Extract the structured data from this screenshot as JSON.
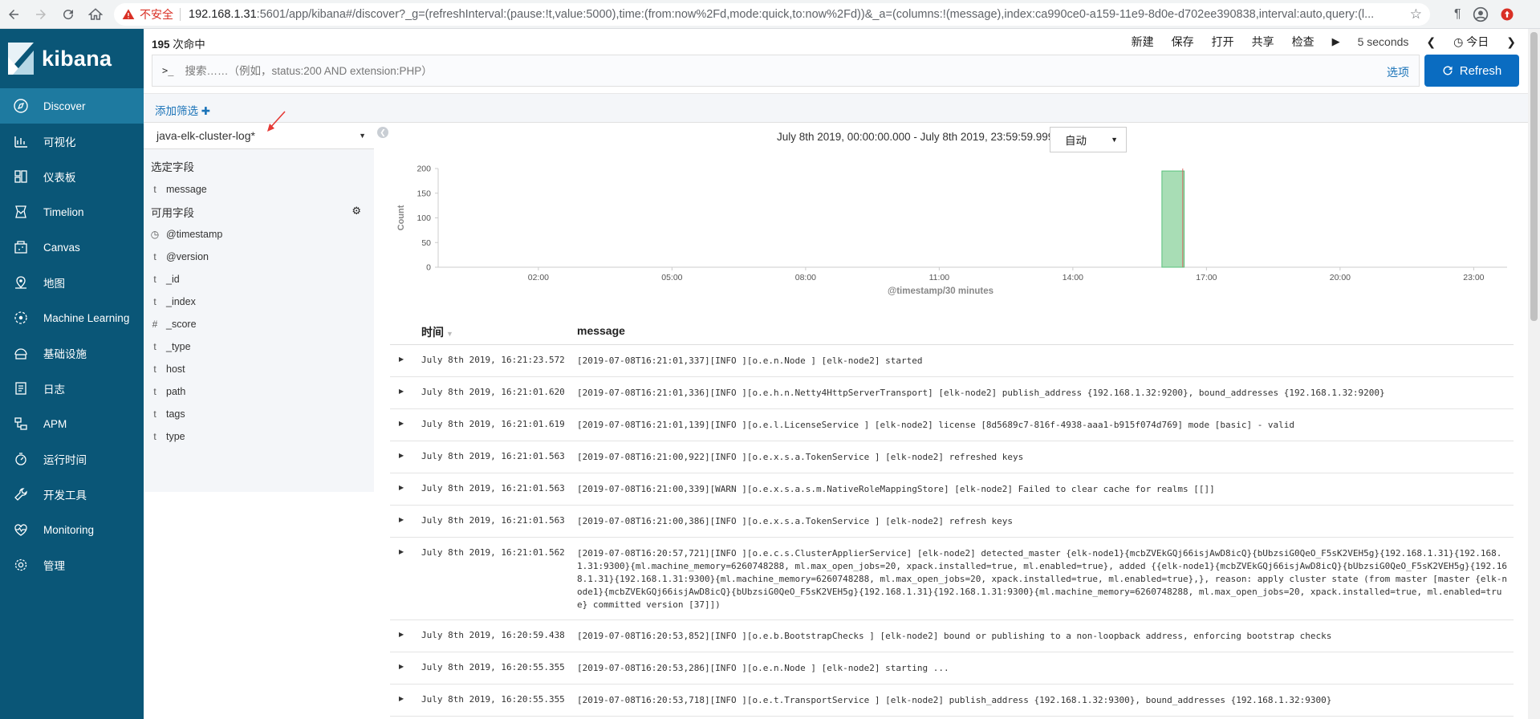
{
  "browser": {
    "security_label": "不安全",
    "url_host": "192.168.1.31",
    "url_rest": ":5601/app/kibana#/discover?_g=(refreshInterval:(pause:!t,value:5000),time:(from:now%2Fd,mode:quick,to:now%2Fd))&_a=(columns:!(message),index:ca990ce0-a159-11e9-8d0e-d702ee390838,interval:auto,query:(l..."
  },
  "brand": {
    "name": "kibana"
  },
  "sidebar": {
    "items": [
      {
        "label": "Discover",
        "icon": "compass-icon"
      },
      {
        "label": "可视化",
        "icon": "visualize-icon"
      },
      {
        "label": "仪表板",
        "icon": "dashboard-icon"
      },
      {
        "label": "Timelion",
        "icon": "timelion-icon"
      },
      {
        "label": "Canvas",
        "icon": "canvas-icon"
      },
      {
        "label": "地图",
        "icon": "map-icon"
      },
      {
        "label": "Machine Learning",
        "icon": "ml-icon"
      },
      {
        "label": "基础设施",
        "icon": "infrastructure-icon"
      },
      {
        "label": "日志",
        "icon": "logs-icon"
      },
      {
        "label": "APM",
        "icon": "apm-icon"
      },
      {
        "label": "运行时间",
        "icon": "uptime-icon"
      },
      {
        "label": "开发工具",
        "icon": "devtools-icon"
      },
      {
        "label": "Monitoring",
        "icon": "monitoring-icon"
      },
      {
        "label": "管理",
        "icon": "gear-icon"
      }
    ]
  },
  "toolbar": {
    "hits_count": "195",
    "hits_label": "次命中",
    "menu": [
      "新建",
      "保存",
      "打开",
      "共享",
      "检查"
    ],
    "refresh_interval": "5 seconds",
    "date_label": "今日",
    "search_placeholder": "搜索……（例如，status:200 AND extension:PHP）",
    "options_label": "选项",
    "refresh_label": "Refresh"
  },
  "filters": {
    "add_label": "添加筛选"
  },
  "fields_panel": {
    "index_pattern": "java-elk-cluster-log*",
    "selected_title": "选定字段",
    "selected": [
      {
        "type": "t",
        "name": "message"
      }
    ],
    "available_title": "可用字段",
    "available": [
      {
        "type": "◷",
        "name": "@timestamp"
      },
      {
        "type": "t",
        "name": "@version"
      },
      {
        "type": "t",
        "name": "_id"
      },
      {
        "type": "t",
        "name": "_index"
      },
      {
        "type": "#",
        "name": "_score"
      },
      {
        "type": "t",
        "name": "_type"
      },
      {
        "type": "t",
        "name": "host"
      },
      {
        "type": "t",
        "name": "path"
      },
      {
        "type": "t",
        "name": "tags"
      },
      {
        "type": "t",
        "name": "type"
      }
    ]
  },
  "histogram_header": {
    "time_range": "July 8th 2019, 00:00:00.000 - July 8th 2019, 23:59:59.999 —",
    "interval": "自动"
  },
  "chart_data": {
    "type": "bar",
    "xlabel": "@timestamp/30 minutes",
    "ylabel": "Count",
    "ylim": [
      0,
      200
    ],
    "yticks": [
      0,
      50,
      100,
      150,
      200
    ],
    "xlim_hours": [
      -0.25,
      23.75
    ],
    "xticks": [
      "02:00",
      "05:00",
      "08:00",
      "11:00",
      "14:00",
      "17:00",
      "20:00",
      "23:00"
    ],
    "bucket_minutes": 30,
    "bars": [
      {
        "start": "16:00",
        "value": 195
      }
    ],
    "current_time_marker": "16:28",
    "bar_color": "#a8ddb5",
    "bar_border": "#57c17b",
    "marker_color": "#d9534f"
  },
  "table": {
    "headers": {
      "time": "时间",
      "message": "message"
    },
    "rows": [
      {
        "time": "July 8th 2019, 16:21:23.572",
        "message": "[2019-07-08T16:21:01,337][INFO ][o.e.n.Node               ] [elk-node2] started"
      },
      {
        "time": "July 8th 2019, 16:21:01.620",
        "message": "[2019-07-08T16:21:01,336][INFO ][o.e.h.n.Netty4HttpServerTransport] [elk-node2] publish_address {192.168.1.32:9200}, bound_addresses {192.168.1.32:9200}"
      },
      {
        "time": "July 8th 2019, 16:21:01.619",
        "message": "[2019-07-08T16:21:01,139][INFO ][o.e.l.LicenseService     ] [elk-node2] license [8d5689c7-816f-4938-aaa1-b915f074d769] mode [basic] - valid"
      },
      {
        "time": "July 8th 2019, 16:21:01.563",
        "message": "[2019-07-08T16:21:00,922][INFO ][o.e.x.s.a.TokenService   ] [elk-node2] refreshed keys"
      },
      {
        "time": "July 8th 2019, 16:21:01.563",
        "message": "[2019-07-08T16:21:00,339][WARN ][o.e.x.s.a.s.m.NativeRoleMappingStore] [elk-node2] Failed to clear cache for realms [[]]"
      },
      {
        "time": "July 8th 2019, 16:21:01.563",
        "message": "[2019-07-08T16:21:00,386][INFO ][o.e.x.s.a.TokenService   ] [elk-node2] refresh keys"
      },
      {
        "time": "July 8th 2019, 16:21:01.562",
        "message": "[2019-07-08T16:20:57,721][INFO ][o.e.c.s.ClusterApplierService] [elk-node2] detected_master {elk-node1}{mcbZVEkGQj66isjAwD8icQ}{bUbzsiG0QeO_F5sK2VEH5g}{192.168.1.31}{192.168.1.31:9300}{ml.machine_memory=6260748288, ml.max_open_jobs=20, xpack.installed=true, ml.enabled=true}, added {{elk-node1}{mcbZVEkGQj66isjAwD8icQ}{bUbzsiG0QeO_F5sK2VEH5g}{192.168.1.31}{192.168.1.31:9300}{ml.machine_memory=6260748288, ml.max_open_jobs=20, xpack.installed=true, ml.enabled=true},}, reason: apply cluster state (from master [master {elk-node1}{mcbZVEkGQj66isjAwD8icQ}{bUbzsiG0QeO_F5sK2VEH5g}{192.168.1.31}{192.168.1.31:9300}{ml.machine_memory=6260748288, ml.max_open_jobs=20, xpack.installed=true, ml.enabled=true} committed version [37]])"
      },
      {
        "time": "July 8th 2019, 16:20:59.438",
        "message": "[2019-07-08T16:20:53,852][INFO ][o.e.b.BootstrapChecks    ] [elk-node2] bound or publishing to a non-loopback address, enforcing bootstrap checks"
      },
      {
        "time": "July 8th 2019, 16:20:55.355",
        "message": "[2019-07-08T16:20:53,286][INFO ][o.e.n.Node               ] [elk-node2] starting ..."
      },
      {
        "time": "July 8th 2019, 16:20:55.355",
        "message": "[2019-07-08T16:20:53,718][INFO ][o.e.t.TransportService   ] [elk-node2] publish_address {192.168.1.32:9300}, bound_addresses {192.168.1.32:9300}"
      }
    ]
  }
}
